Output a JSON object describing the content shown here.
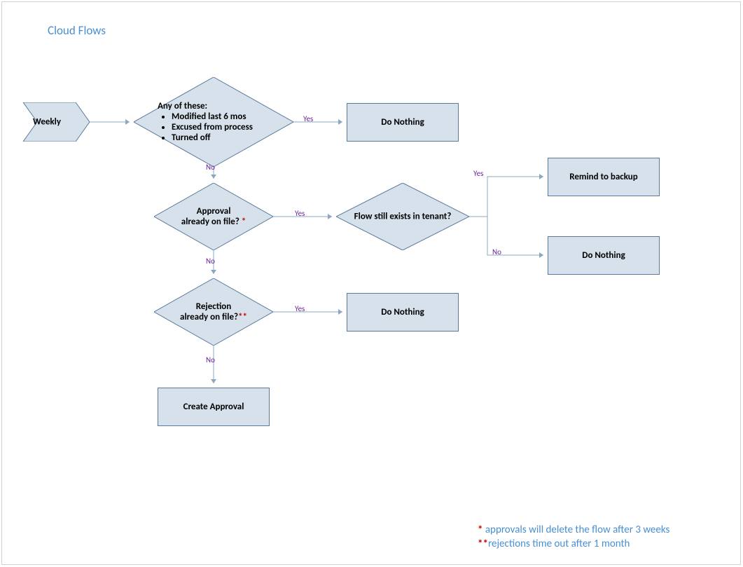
{
  "title": "Cloud Flows",
  "trigger": "Weekly",
  "decision1": {
    "header": "Any of these:",
    "items": [
      "Modified last 6 mos",
      "Excused from process",
      "Turned off"
    ]
  },
  "decision2_line1": "Approval",
  "decision2_line2": "already on file? ",
  "decision2_star": "*",
  "decision3": "Flow still exists in tenant?",
  "decision4_line1": "Rejection",
  "decision4_line2": "already on file?",
  "decision4_star": "**",
  "box_do_nothing": "Do Nothing",
  "box_remind": "Remind to backup",
  "box_create": "Create Approval",
  "label_yes": "Yes",
  "label_no": "No",
  "footnote1_star": "* ",
  "footnote1_text": "approvals will delete the flow after 3 weeks",
  "footnote2_star": "**",
  "footnote2_text": "rejections time out after 1 month"
}
